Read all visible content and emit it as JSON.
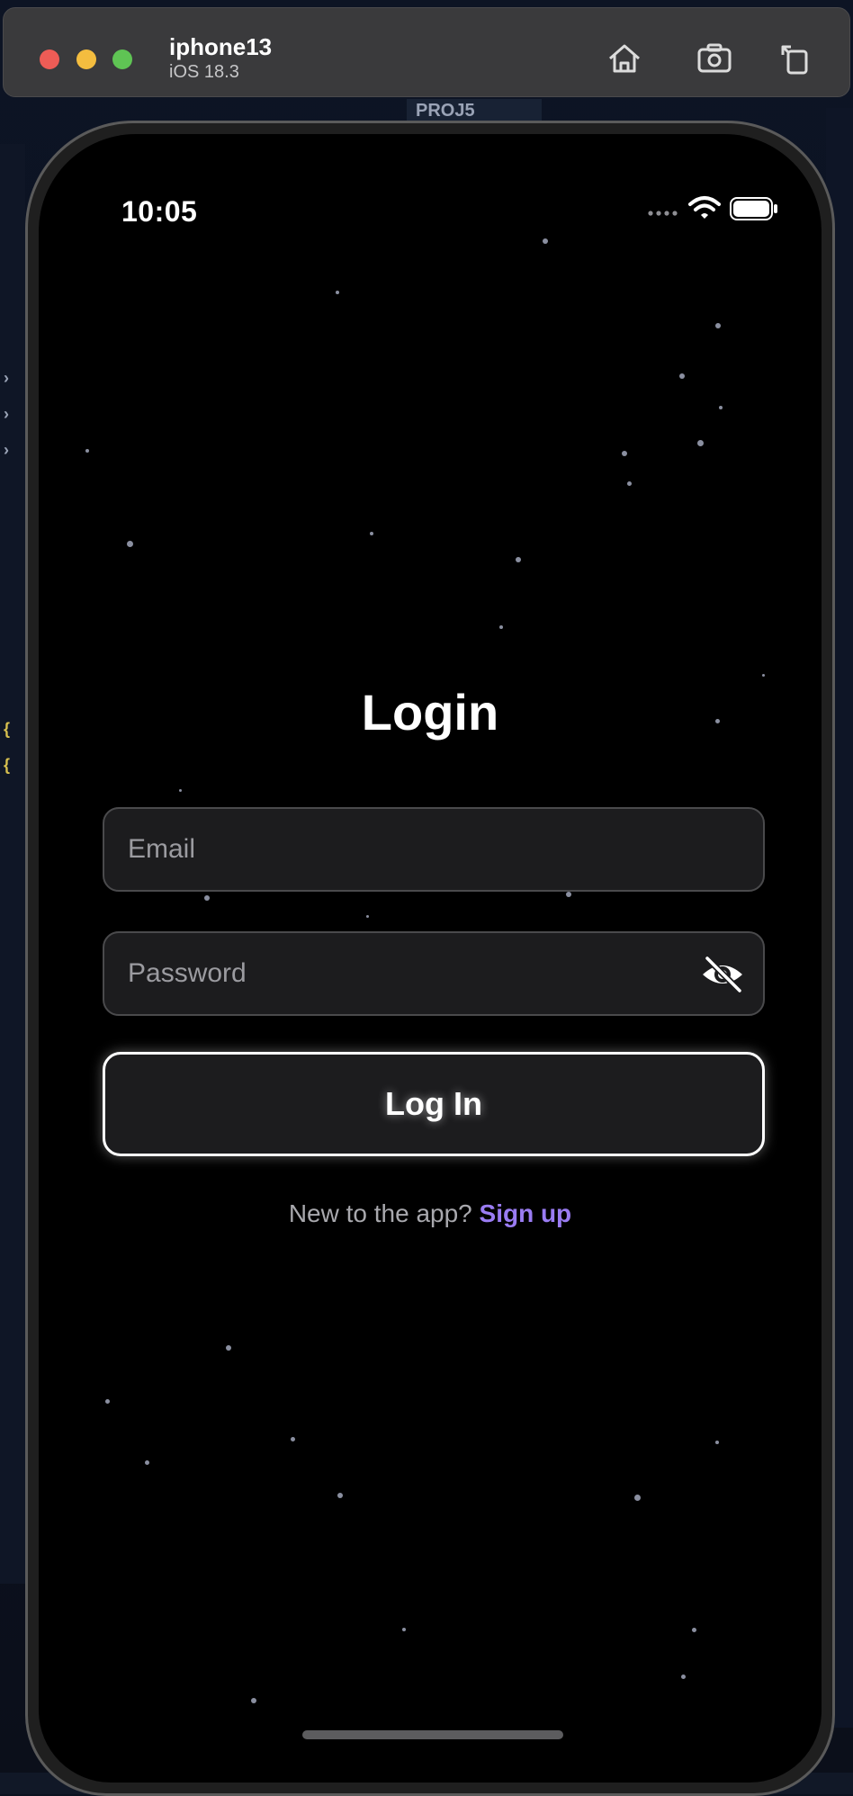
{
  "simulator": {
    "device_name": "iphone13",
    "os_version": "iOS 18.3",
    "controls": [
      "home-icon",
      "screenshot-icon",
      "rotate-icon"
    ]
  },
  "ide": {
    "project_label": "PROJ5"
  },
  "status_bar": {
    "time": "10:05",
    "icons": [
      "cellular-icon",
      "wifi-icon",
      "battery-icon"
    ]
  },
  "login": {
    "title": "Login",
    "email_placeholder": "Email",
    "password_placeholder": "Password",
    "toggle_icon": "eye-slash-icon",
    "submit_label": "Log In",
    "signup_prompt": "New to the app?",
    "signup_link": "Sign up"
  },
  "colors": {
    "background": "#000000",
    "field_background": "#1c1c1e",
    "accent_link": "#9a7cf3",
    "button_border": "#ffffff"
  }
}
